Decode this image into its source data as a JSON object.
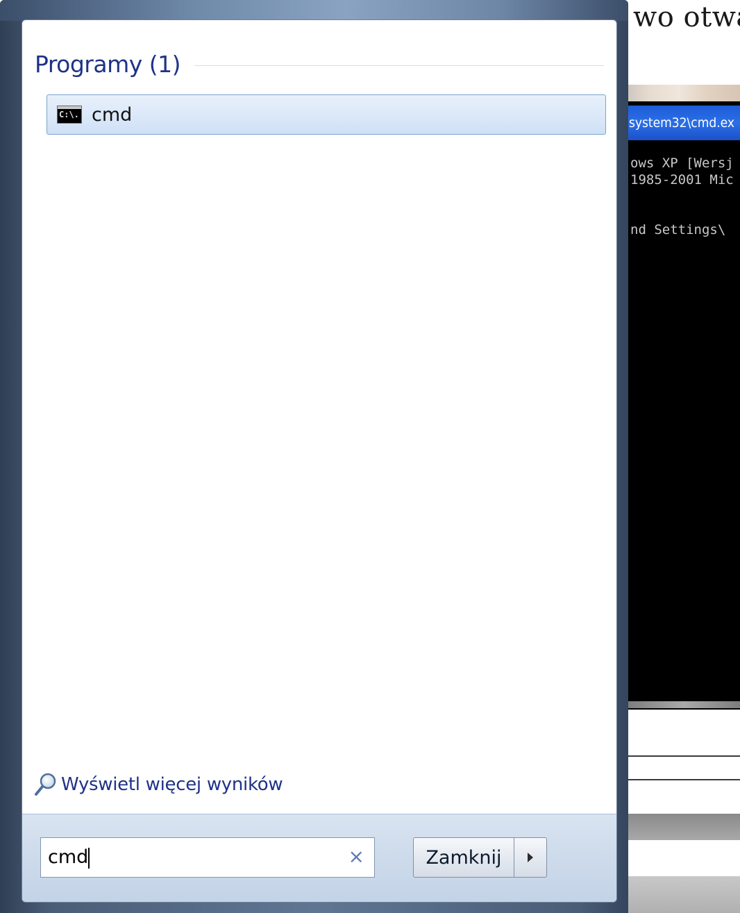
{
  "background": {
    "document_text": "wo otwa",
    "cmd_window": {
      "title": "system32\\cmd.ex",
      "lines": [
        "ows XP [Wersj",
        "1985-2001 Mic",
        "nd Settings\\"
      ]
    }
  },
  "start_menu": {
    "section_title": "Programy (1)",
    "results": [
      {
        "label": "cmd",
        "icon": "cmd-console-icon"
      }
    ],
    "more_results_label": "Wyświetl więcej wyników",
    "search": {
      "value": "cmd",
      "clear_icon": "×"
    },
    "shutdown": {
      "label": "Zamknij",
      "arrow_icon": "chevron-right-icon"
    }
  }
}
